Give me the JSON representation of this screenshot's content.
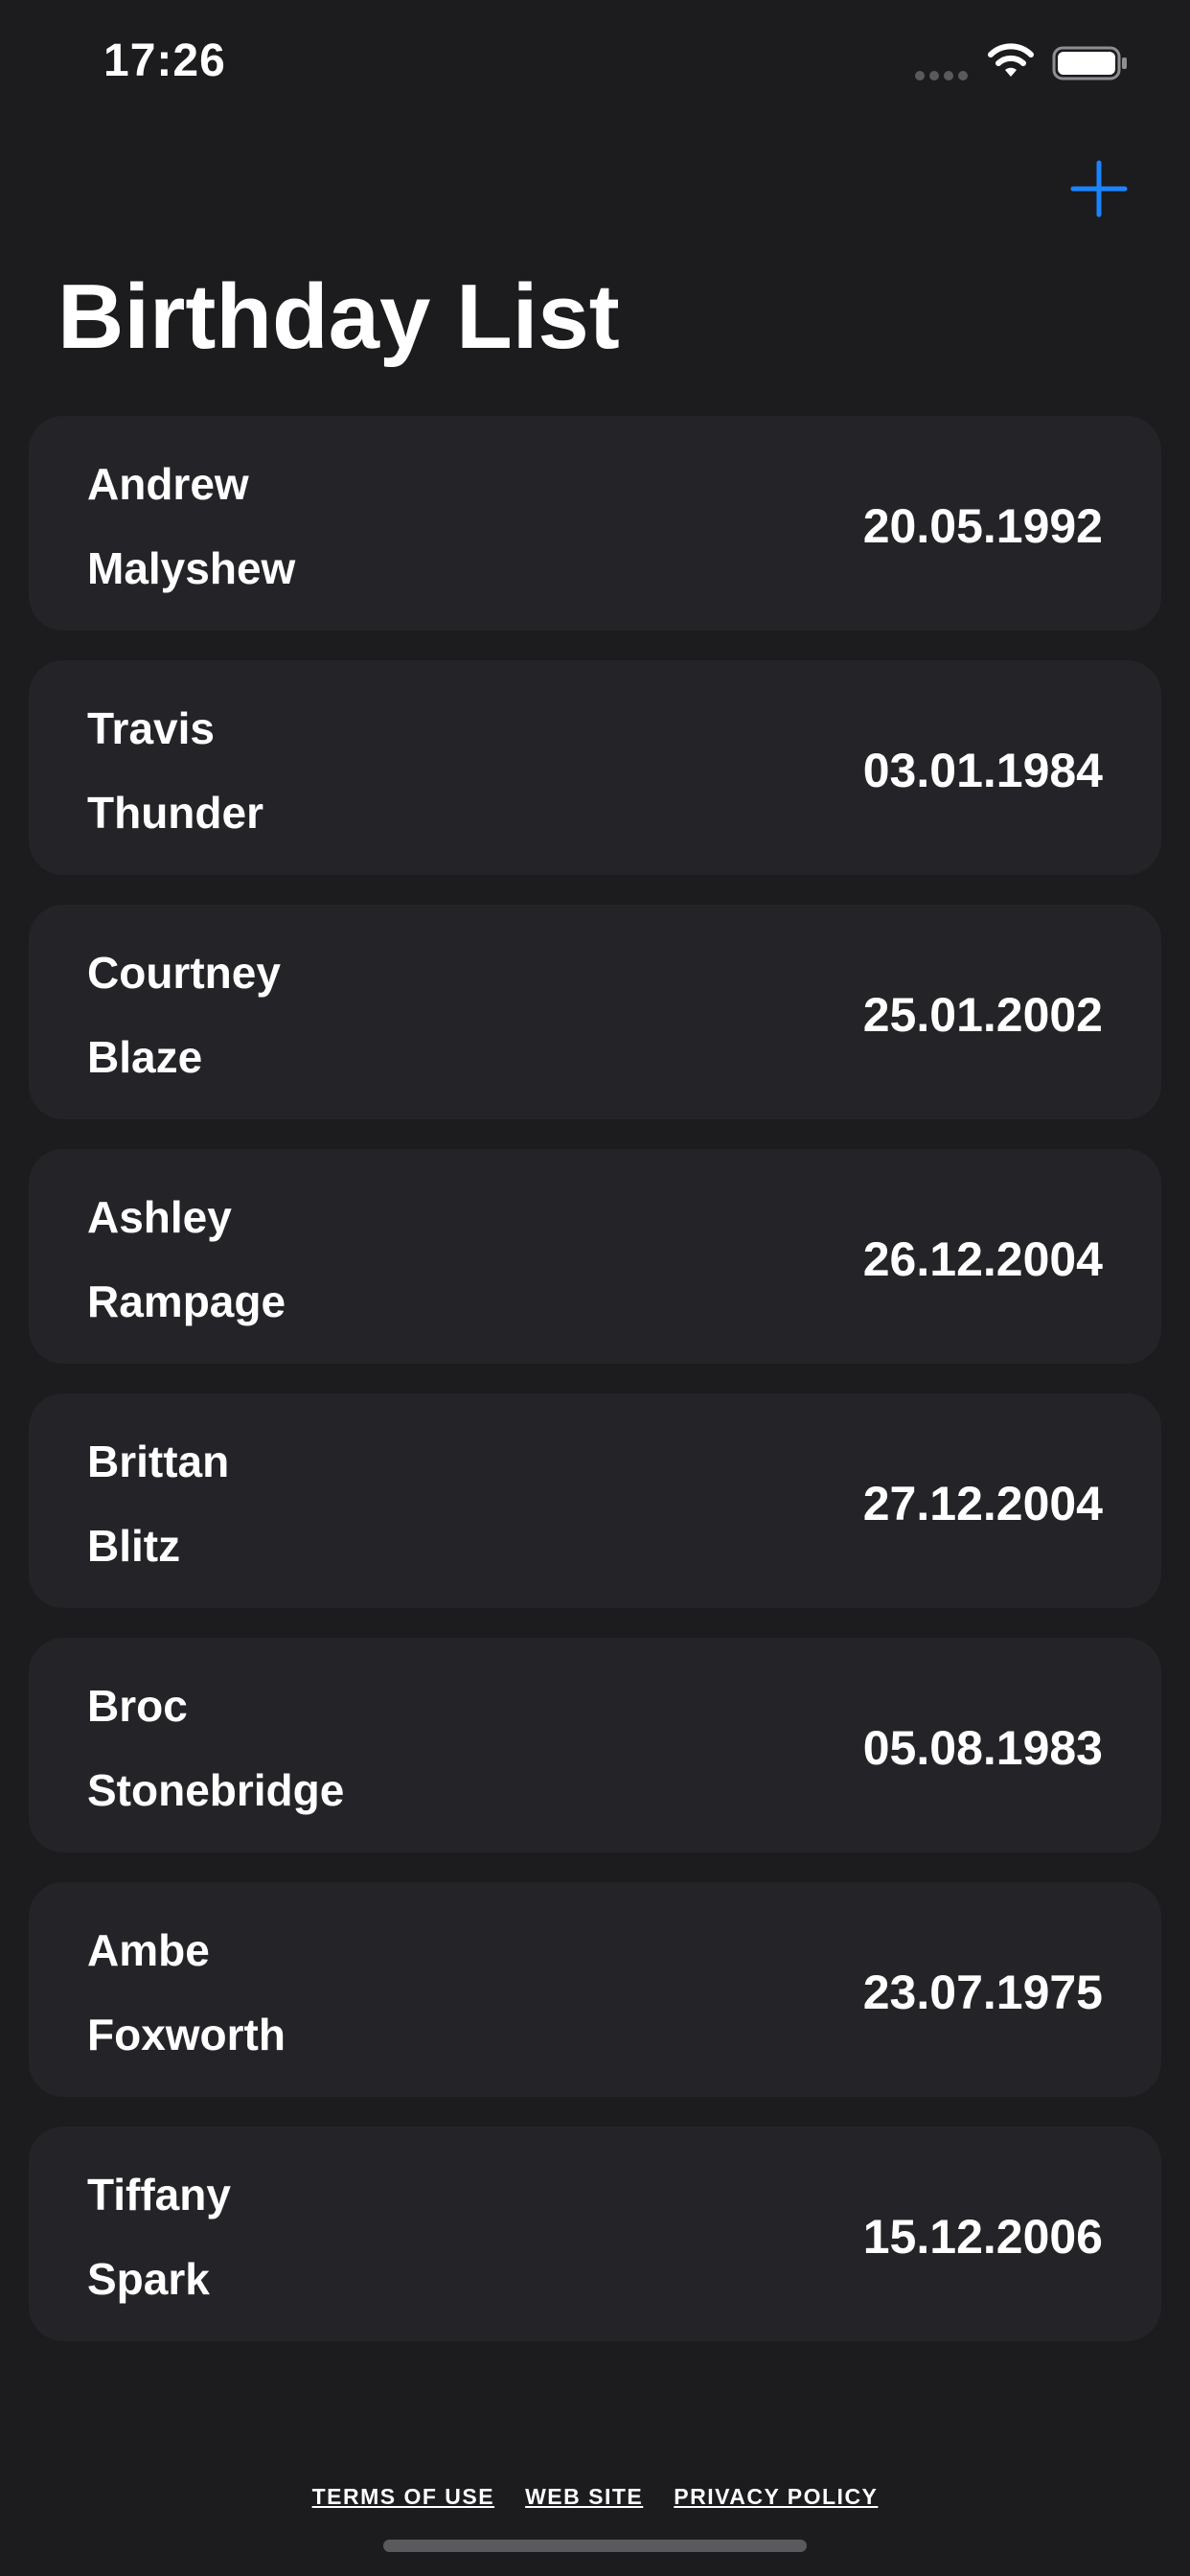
{
  "status_bar": {
    "time": "17:26"
  },
  "header": {
    "add_icon": "plus-icon",
    "title": "Birthday List"
  },
  "birthdays": [
    {
      "first": "Andrew",
      "last": "Malyshew",
      "date": "20.05.1992"
    },
    {
      "first": "Travis",
      "last": "Thunder",
      "date": "03.01.1984"
    },
    {
      "first": "Courtney",
      "last": "Blaze",
      "date": "25.01.2002"
    },
    {
      "first": "Ashley",
      "last": "Rampage",
      "date": "26.12.2004"
    },
    {
      "first": "Brittan",
      "last": "Blitz",
      "date": "27.12.2004"
    },
    {
      "first": "Broc",
      "last": "Stonebridge",
      "date": "05.08.1983"
    },
    {
      "first": "Ambe",
      "last": "Foxworth",
      "date": "23.07.1975"
    },
    {
      "first": "Tiffany",
      "last": "Spark",
      "date": "15.12.2006"
    }
  ],
  "footer": {
    "terms": "TERMS OF USE",
    "website": "WEB SITE",
    "privacy": "PRIVACY POLICY"
  },
  "colors": {
    "background": "#1c1c1e",
    "card": "#242428",
    "accent": "#1a84ff",
    "text": "#ffffff"
  }
}
